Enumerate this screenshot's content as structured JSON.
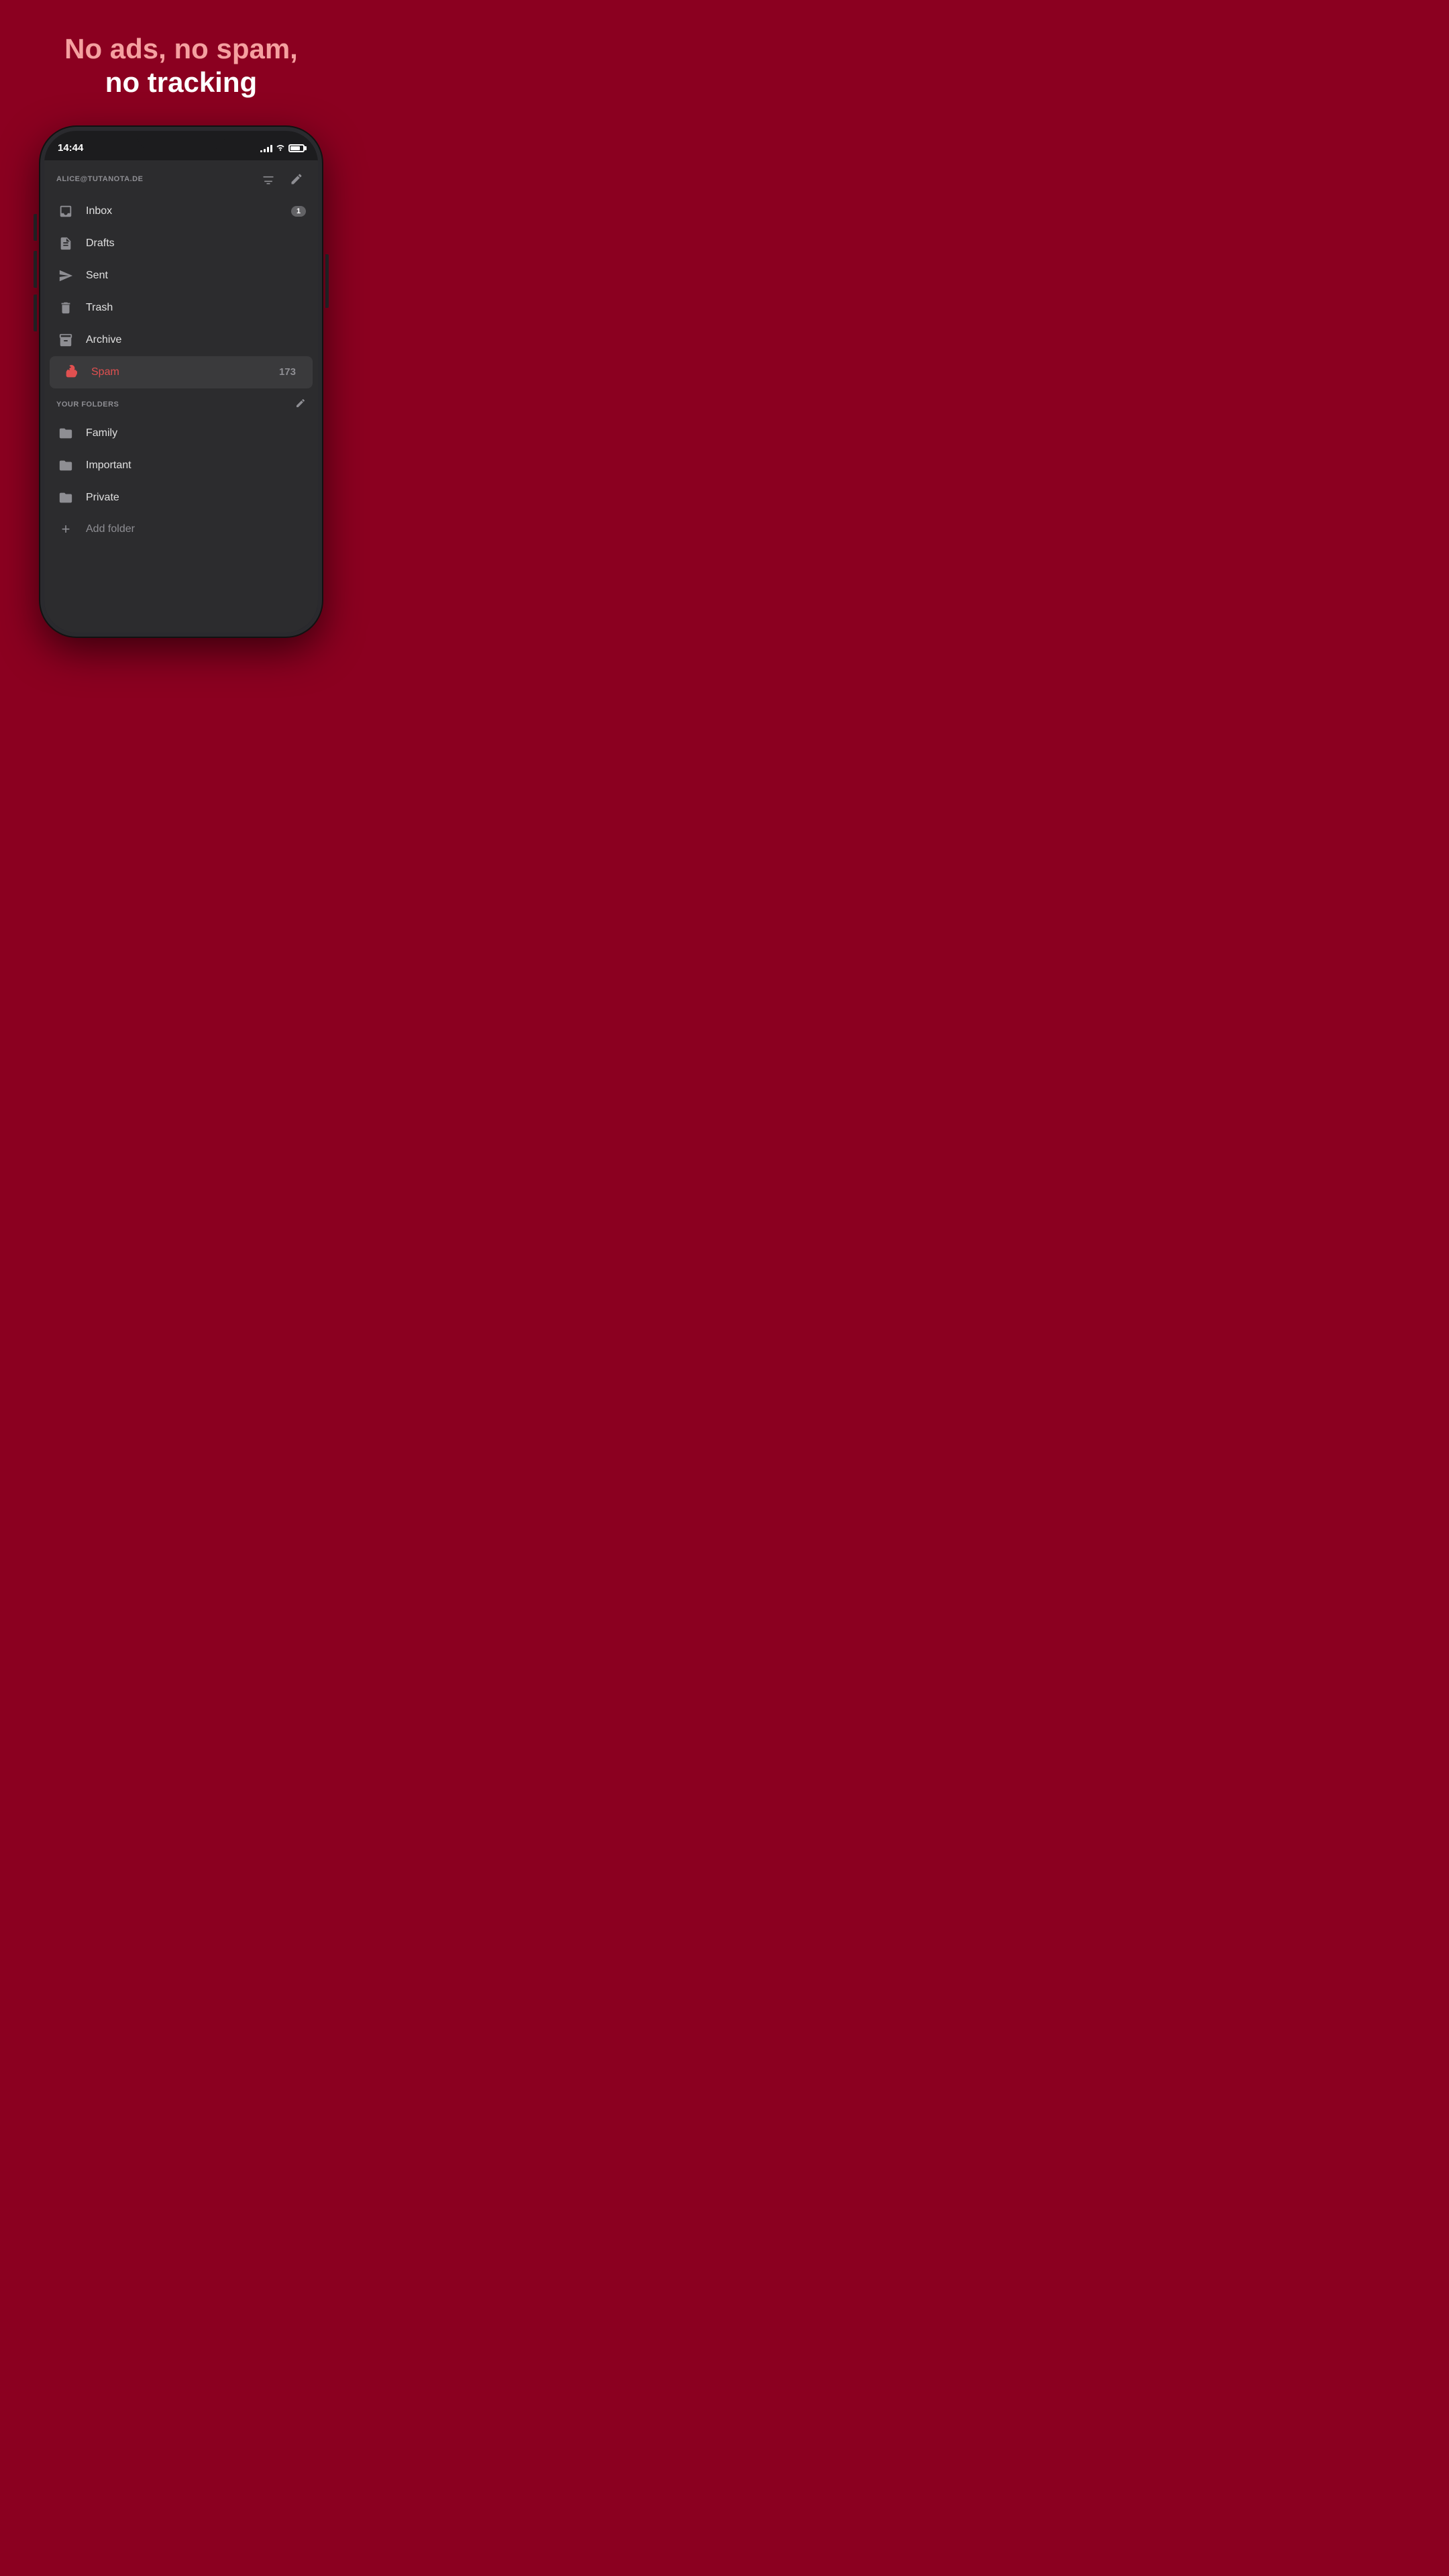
{
  "headline": {
    "line1": "No ads, no spam,",
    "line2": "no tracking"
  },
  "status_bar": {
    "time": "14:44"
  },
  "account": {
    "email": "ALICE@TUTANOTA.DE"
  },
  "menu_items": [
    {
      "id": "inbox",
      "label": "Inbox",
      "badge": "1",
      "active": false
    },
    {
      "id": "drafts",
      "label": "Drafts",
      "badge": "",
      "active": false
    },
    {
      "id": "sent",
      "label": "Sent",
      "badge": "",
      "active": false
    },
    {
      "id": "trash",
      "label": "Trash",
      "badge": "",
      "active": false
    },
    {
      "id": "archive",
      "label": "Archive",
      "badge": "",
      "active": false
    },
    {
      "id": "spam",
      "label": "Spam",
      "badge": "173",
      "active": true
    }
  ],
  "folders_section": {
    "title": "YOUR FOLDERS"
  },
  "folders": [
    {
      "id": "family",
      "label": "Family"
    },
    {
      "id": "important",
      "label": "Important"
    },
    {
      "id": "private",
      "label": "Private"
    }
  ],
  "add_folder_label": "Add folder"
}
